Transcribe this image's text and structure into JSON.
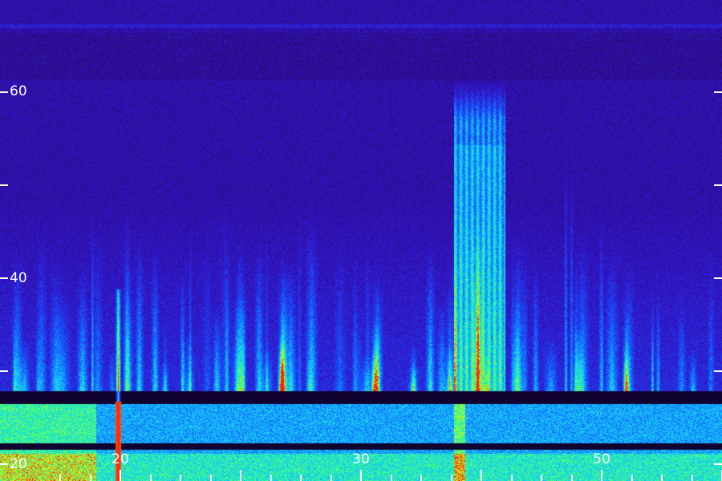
{
  "spectrogram": {
    "y_axis": {
      "labels": [
        "60",
        "40",
        "20"
      ],
      "tick_values": [
        60,
        50,
        40,
        30,
        20
      ]
    },
    "x_axis": {
      "labels": [
        "20",
        "30",
        "50"
      ],
      "tick_values": [
        10,
        12,
        14,
        16,
        18,
        20,
        22,
        24,
        26,
        28,
        30,
        32,
        34,
        36,
        38,
        40,
        42,
        44,
        46,
        48,
        50,
        52,
        54,
        56,
        58
      ]
    },
    "colors": {
      "background": "#1c0a4a",
      "low": "#3a0ca8",
      "mid": "#1a6cff",
      "high": "#20e0ff",
      "hot": "#ff2010",
      "accent": "#7cff20"
    }
  }
}
